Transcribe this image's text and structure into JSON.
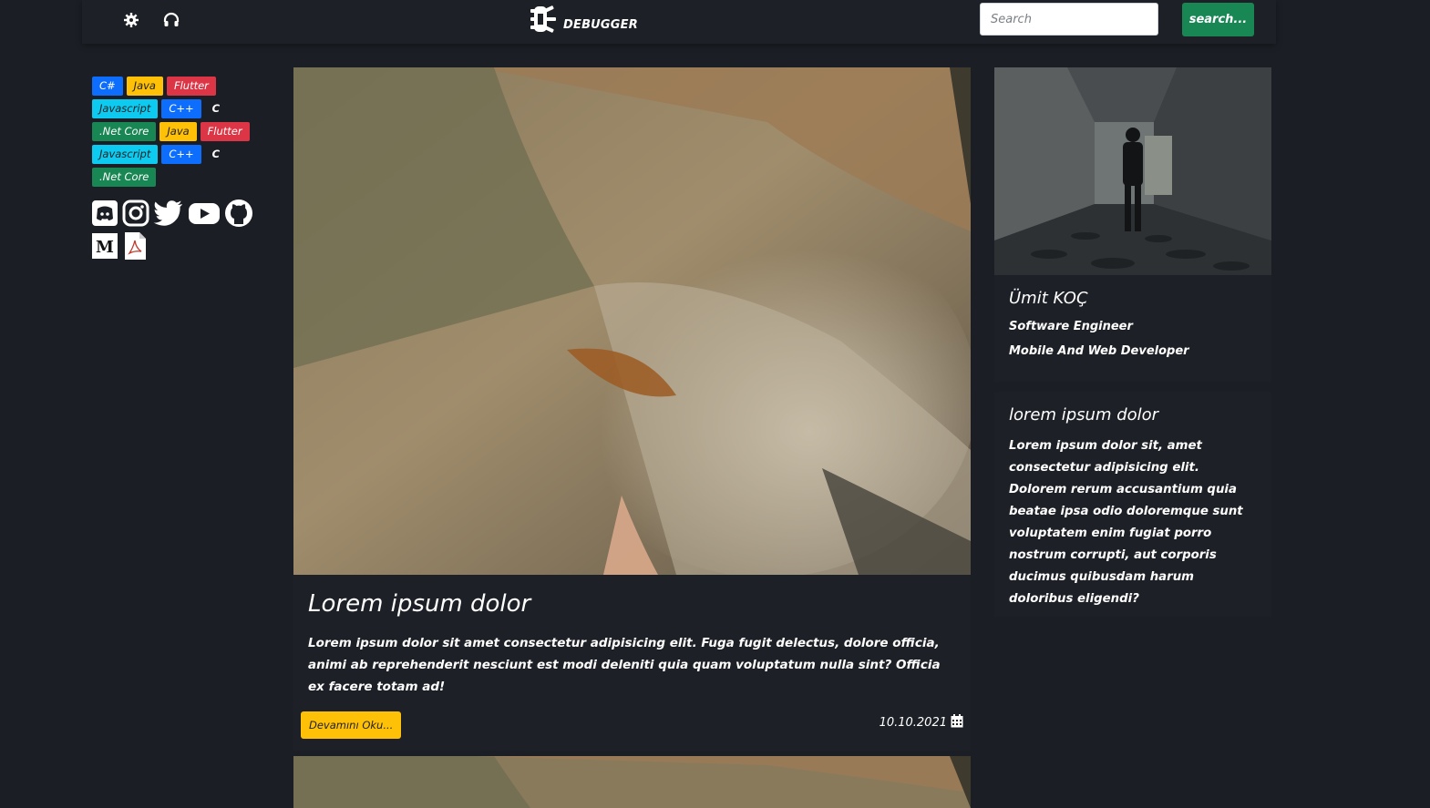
{
  "header": {
    "brand": "DEBUGGER",
    "search_placeholder": "Search",
    "search_button": "search..."
  },
  "tags": {
    "rows": [
      [
        "C#",
        "Java",
        "Flutter"
      ],
      [
        "Javascript",
        "C++",
        "C"
      ],
      [
        ".Net Core",
        "Java",
        "Flutter"
      ],
      [
        "Javascript",
        "C++",
        "C"
      ],
      [
        ".Net Core"
      ]
    ]
  },
  "social": {
    "icons": [
      "discord-icon",
      "instagram-icon",
      "twitter-icon",
      "youtube-icon",
      "github-icon",
      "medium-icon",
      "pdf-icon"
    ]
  },
  "post": {
    "title": "Lorem ipsum dolor",
    "body": "Lorem ipsum dolor sit amet consectetur adipisicing elit. Fuga fugit delectus, dolore officia, animi ab reprehenderit nesciunt est modi deleniti quia quam voluptatum nulla sint? Officia ex facere totam ad!",
    "read_more": "Devamını Oku...",
    "date": "10.10.2021"
  },
  "profile": {
    "name": "Ümit KOÇ",
    "role": "Software Engineer",
    "subtitle": "Mobile And Web Developer"
  },
  "about": {
    "title": "lorem ipsum dolor",
    "text": "Lorem ipsum dolor sit, amet consectetur adipisicing elit. Dolorem rerum accusantium quia beatae ipsa odio doloremque sunt voluptatem enim fugiat porro nostrum corrupti, aut corporis ducimus quibusdam harum doloribus eligendi?"
  },
  "colors": {
    "background": "#1b1f25",
    "primary": "#0d6efd",
    "warning": "#ffc107",
    "danger": "#dc3545",
    "info": "#0dcaf0",
    "success": "#198754"
  }
}
